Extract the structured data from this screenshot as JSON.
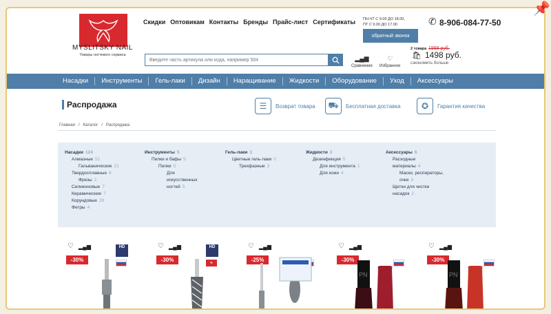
{
  "header": {
    "logo_brand": "MYSLITSKY NAIL",
    "logo_sub": "Товары ногтевого сервиса",
    "nav": [
      "Скидки",
      "Оптовикам",
      "Контакты",
      "Бренды",
      "Прайс-лист",
      "Сертификаты"
    ],
    "hours_line1": "ПН-ЧТ С 9.00 ДО 18.00,",
    "hours_line2": "ПТ С 9.00 ДО 17.00",
    "callback_label": "обратный звонок",
    "phone": "8-906-084-77-50",
    "search_placeholder": "Введите часть артикула или кода, например 504",
    "compare_label": "Сравнение",
    "favorites_label": "Избранное",
    "cart_count": "2 товара",
    "cart_old_price": "1998 руб.",
    "cart_total": "1498 руб.",
    "cart_save": "сэкономить больше"
  },
  "menu": [
    "Насадки",
    "Инструменты",
    "Гель-лаки",
    "Дизайн",
    "Наращивание",
    "Жидкости",
    "Оборудование",
    "Уход",
    "Аксессуары"
  ],
  "page": {
    "title": "Распродажа",
    "benefits": [
      "Возврат товара",
      "Бесплатная доставка",
      "Гарантия качества"
    ],
    "breadcrumbs": [
      "Главная",
      "/",
      "Каталог",
      "/",
      "Распродажа"
    ]
  },
  "categories": {
    "col1": [
      {
        "label": "Насадки",
        "count": "124",
        "level": "head"
      },
      {
        "label": "Алмазные",
        "count": "51",
        "level": "l2"
      },
      {
        "label": "Гальванические",
        "count": "21",
        "level": "l3"
      },
      {
        "label": "Твердосплавные",
        "count": "6",
        "level": "l2"
      },
      {
        "label": "Фрезы",
        "count": "2",
        "level": "l3"
      },
      {
        "label": "Силиконовые",
        "count": "7",
        "level": "l2"
      },
      {
        "label": "Керамические",
        "count": "7",
        "level": "l2"
      },
      {
        "label": "Корундовые",
        "count": "28",
        "level": "l2"
      },
      {
        "label": "Фетры",
        "count": "4",
        "level": "l2"
      }
    ],
    "col2": [
      {
        "label": "Инструменты",
        "count": "5",
        "level": "head"
      },
      {
        "label": "Пилки и бафы",
        "count": "5",
        "level": "l2"
      },
      {
        "label": "Пилки",
        "count": "5",
        "level": "l3"
      },
      {
        "label": "Для",
        "count": "",
        "level": "l4"
      },
      {
        "label": "искусственных",
        "count": "",
        "level": "l4"
      },
      {
        "label": "ногтей",
        "count": "5",
        "level": "l4"
      }
    ],
    "col3": [
      {
        "label": "Гель-лаки",
        "count": "3",
        "level": "head"
      },
      {
        "label": "Цветные гель-лаки",
        "count": "0",
        "level": "l2"
      },
      {
        "label": "Трехфазные",
        "count": "3",
        "level": "l3"
      }
    ],
    "col4": [
      {
        "label": "Жидкости",
        "count": "3",
        "level": "head"
      },
      {
        "label": "Дезинфекция",
        "count": "5",
        "level": "l2"
      },
      {
        "label": "Для инструмента",
        "count": "1",
        "level": "l3"
      },
      {
        "label": "Для кожи",
        "count": "4",
        "level": "l3"
      }
    ],
    "col5": [
      {
        "label": "Аксессуары",
        "count": "6",
        "level": "head"
      },
      {
        "label": "Расходные",
        "count": "",
        "level": "l2"
      },
      {
        "label": "материалы",
        "count": "4",
        "level": "l2"
      },
      {
        "label": "Маски, респираторы,",
        "count": "",
        "level": "l3"
      },
      {
        "label": "очки",
        "count": "3",
        "level": "l3"
      },
      {
        "label": "Щетки для чистки",
        "count": "",
        "level": "l2"
      },
      {
        "label": "насадок",
        "count": "2",
        "level": "l2"
      }
    ]
  },
  "products": [
    {
      "discount": "-30%",
      "brand": "HD",
      "flag": "ru",
      "kind": "bur-blue"
    },
    {
      "discount": "-30%",
      "brand": "HD",
      "flag": "ch",
      "kind": "bur-carbide"
    },
    {
      "discount": "-25%",
      "brand": "",
      "flag": "ru",
      "kind": "bur-kit"
    },
    {
      "discount": "-30%",
      "brand": "",
      "flag": "ru",
      "kind": "bottle-wine"
    },
    {
      "discount": "-30%",
      "brand": "",
      "flag": "ru",
      "kind": "bottle-red"
    }
  ],
  "colors": {
    "accent": "#4f7ea8",
    "sale": "#d8292f",
    "panel": "#e6edf4"
  }
}
